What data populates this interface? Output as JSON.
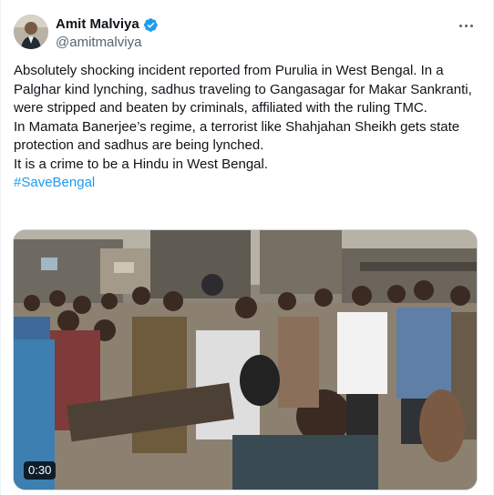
{
  "author": {
    "display_name": "Amit Malviya",
    "handle": "@amitmalviya",
    "verified_color": "#1d9bf0",
    "avatar_icon": "user-avatar"
  },
  "menu": {
    "icon": "more-horizontal-icon"
  },
  "tweet": {
    "paragraphs": [
      "Absolutely shocking incident reported from Purulia in West Bengal. In a Palghar kind lynching, sadhus traveling to Gangasagar for Makar Sankranti, were stripped and beaten by criminals, affiliated with the ruling TMC.",
      "In Mamata Banerjee’s regime, a terrorist like Shahjahan Sheikh gets state protection and sadhus are being lynched.",
      "It is a crime to be a Hindu in West Bengal."
    ],
    "hashtag": "#SaveBengal",
    "hashtag_color": "#1d9bf0"
  },
  "media": {
    "type": "video",
    "duration": "0:30",
    "play_icon": "video-thumbnail"
  }
}
